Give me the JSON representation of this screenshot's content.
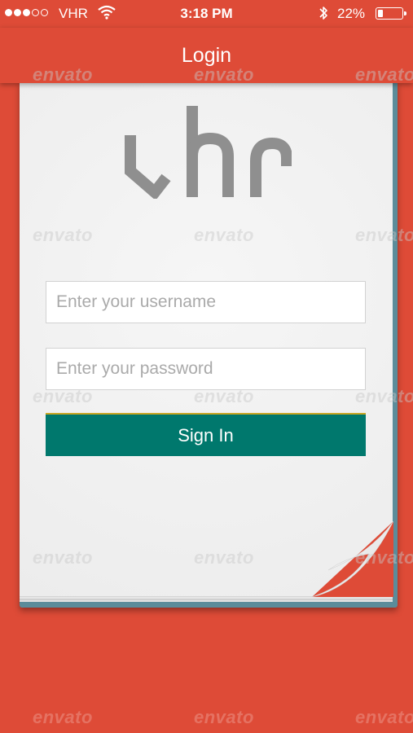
{
  "status_bar": {
    "signal_dots_filled": 3,
    "signal_dots_total": 5,
    "carrier": "VHR",
    "time": "3:18 PM",
    "battery_percent": "22%",
    "battery_level": 0.22
  },
  "nav": {
    "title": "Login"
  },
  "logo": {
    "text": "vhr"
  },
  "form": {
    "username_placeholder": "Enter your username",
    "username_value": "",
    "password_placeholder": "Enter your password",
    "password_value": "",
    "signin_label": "Sign In"
  },
  "watermark": {
    "text": "envato"
  },
  "colors": {
    "background": "#de4b37",
    "button": "#00786d",
    "button_top_border": "#c8a624",
    "notepad_back": "#5b8c9a"
  }
}
